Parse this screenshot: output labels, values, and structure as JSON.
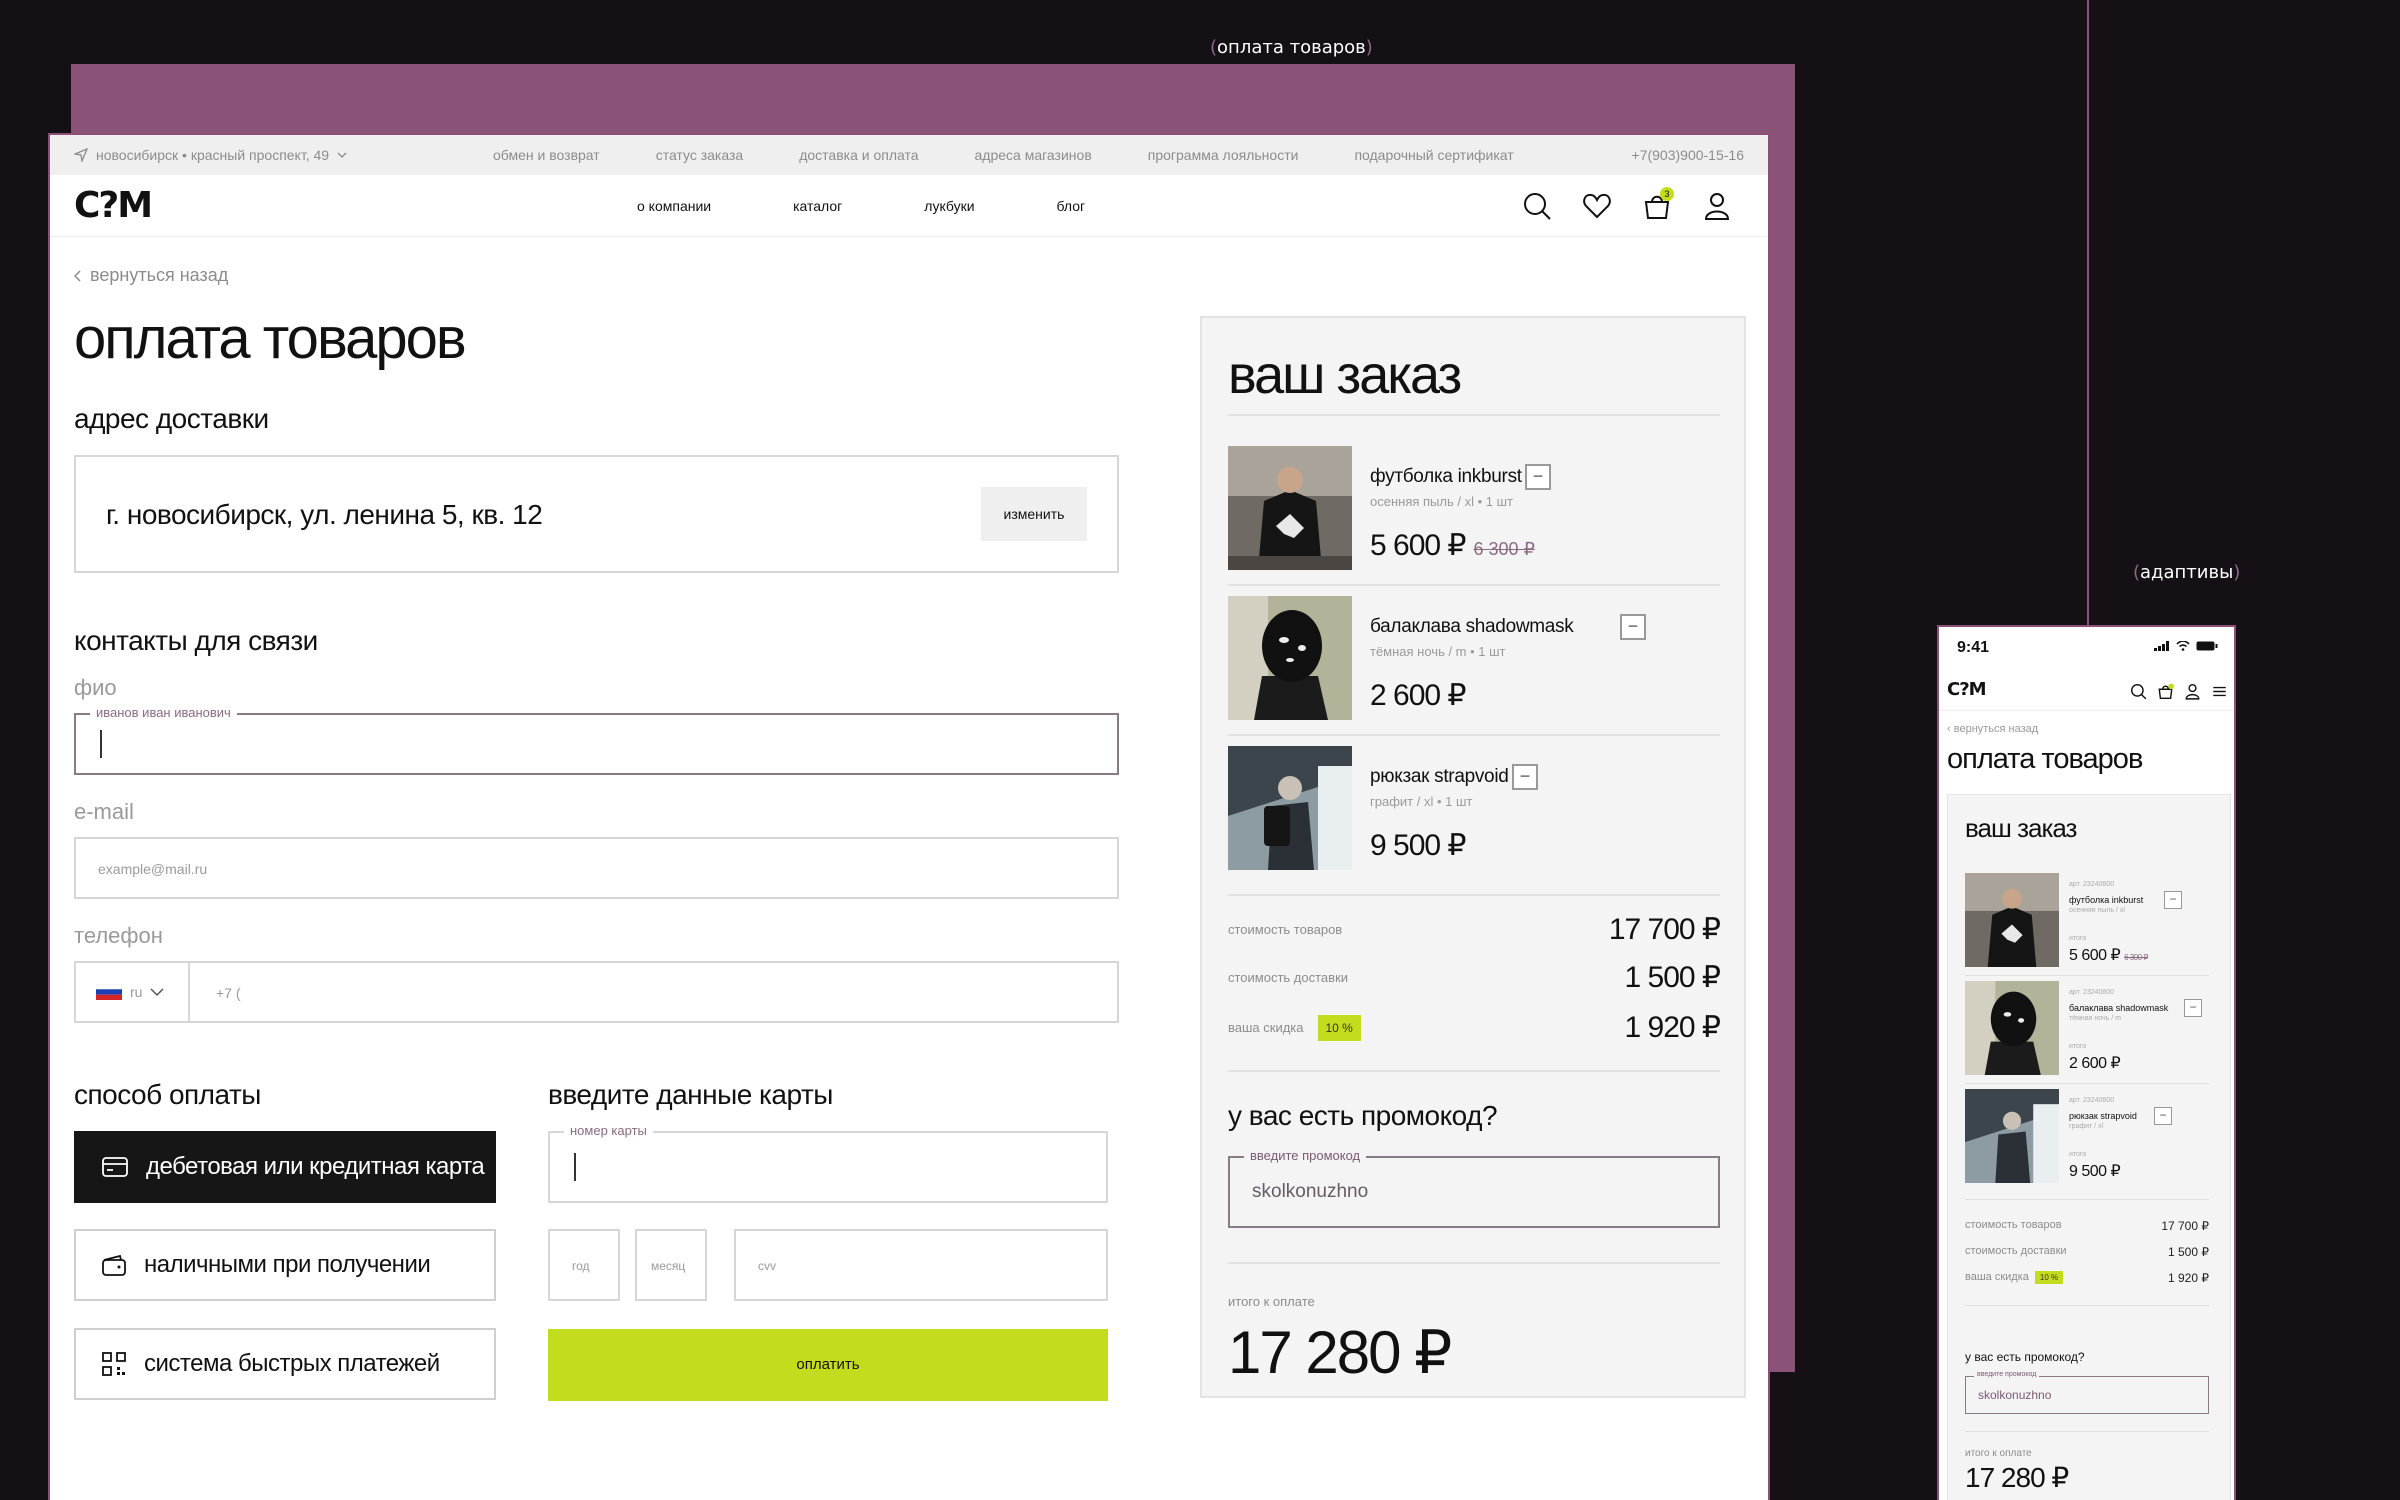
{
  "labels": {
    "payment_section": "оплата товаров",
    "adaptive_section": "адаптивы"
  },
  "topbar": {
    "location": "новосибирск • красный проспект, 49",
    "links": [
      "обмен и возврат",
      "статус заказа",
      "доставка и оплата",
      "адреса магазинов",
      "программа лояльности",
      "подарочный сертификат"
    ],
    "phone": "+7(903)900-15-16"
  },
  "nav": {
    "logo": "C?M",
    "links": [
      "о компании",
      "каталог",
      "лукбуки",
      "блог"
    ],
    "cart_count": "3"
  },
  "page": {
    "back": "вернуться назад",
    "title": "оплата товаров",
    "address_heading": "адрес доставки",
    "address_value": "г. новосибирск, ул. ленина 5, кв. 12",
    "change_button": "изменить",
    "contacts_heading": "контакты для связи",
    "fio_label": "фио",
    "fio_legend": "иванов иван иванович",
    "email_label": "e-mail",
    "email_placeholder": "example@mail.ru",
    "phone_label": "телефон",
    "phone_country": "ru",
    "phone_placeholder": "+7 (",
    "payment_heading": "способ оплаты",
    "payment_methods": [
      "дебетовая или кредитная карта",
      "наличными при получении",
      "система быстрых платежей"
    ],
    "card_heading": "введите данные карты",
    "card_number_legend": "номер карты",
    "year_placeholder": "год",
    "month_placeholder": "месяц",
    "cvv_placeholder": "cvv",
    "pay_button": "оплатить"
  },
  "order": {
    "title": "ваш заказ",
    "items": [
      {
        "name": "футболка inkburst",
        "meta": "осенняя пыль / xl • 1 шт",
        "price": "5 600 ₽",
        "old_price": "6 300 ₽"
      },
      {
        "name": "балаклава shadowmask",
        "meta": "тёмная ночь / m • 1 шт",
        "price": "2 600 ₽",
        "old_price": ""
      },
      {
        "name": "рюкзак strapvoid",
        "meta": "графит / xl • 1 шт",
        "price": "9 500 ₽",
        "old_price": ""
      }
    ],
    "goods_cost_label": "стоимость товаров",
    "goods_cost": "17 700 ₽",
    "delivery_cost_label": "стоимость доставки",
    "delivery_cost": "1 500 ₽",
    "discount_label": "ваша скидка",
    "discount_badge": "10 %",
    "discount_value": "1 920 ₽",
    "promo_heading": "у вас есть промокод?",
    "promo_legend": "введите промокод",
    "promo_value": "skolkonuzhno",
    "total_label": "итого к оплате",
    "total": "17 280 ₽"
  },
  "mobile": {
    "time": "9:41",
    "logo": "C?M",
    "back": "вернуться назад",
    "title": "оплата товаров",
    "order_title": "ваш заказ",
    "sku": "арт. 23240800",
    "itogo": "итого",
    "items": [
      {
        "name": "футболка inkburst",
        "meta": "осенняя пыль / xl",
        "price": "5 600 ₽",
        "old_price": "6 300 ₽"
      },
      {
        "name": "балаклава shadowmask",
        "meta": "тёмная ночь / m",
        "price": "2 600 ₽",
        "old_price": ""
      },
      {
        "name": "рюкзак strapvoid",
        "meta": "графит / xl",
        "price": "9 500 ₽",
        "old_price": ""
      }
    ],
    "goods_cost_label": "стоимость товаров",
    "goods_cost": "17 700 ₽",
    "delivery_cost_label": "стоимость доставки",
    "delivery_cost": "1 500 ₽",
    "discount_label": "ваша скидка",
    "discount_badge": "10 %",
    "discount_value": "1 920 ₽",
    "promo_heading": "у вас есть промокод?",
    "promo_legend": "введите промокод",
    "promo_value": "skolkonuzhno",
    "total_label": "итого к оплате",
    "total": "17 280 ₽"
  },
  "colors": {
    "accent_lime": "#c4dc1e",
    "brand_purple": "#8b5278",
    "dark_button": "#161616"
  }
}
